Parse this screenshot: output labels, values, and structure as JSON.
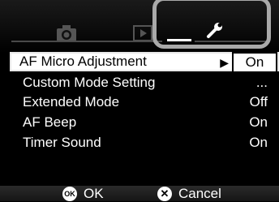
{
  "tabs": [
    {
      "name": "camera",
      "icon": "camera-icon"
    },
    {
      "name": "playback",
      "icon": "playback-icon"
    },
    {
      "name": "setup",
      "icon": "wrench-icon",
      "active": true
    }
  ],
  "menu": {
    "items": [
      {
        "label": "AF Micro Adjustment",
        "value": "On",
        "selected": true
      },
      {
        "label": "Custom Mode Setting",
        "value": "..."
      },
      {
        "label": "Extended Mode",
        "value": "Off"
      },
      {
        "label": "AF Beep",
        "value": "On"
      },
      {
        "label": "Timer Sound",
        "value": "On"
      }
    ]
  },
  "footer": {
    "ok_icon_text": "OK",
    "ok_label": "OK",
    "cancel_label": "Cancel"
  }
}
